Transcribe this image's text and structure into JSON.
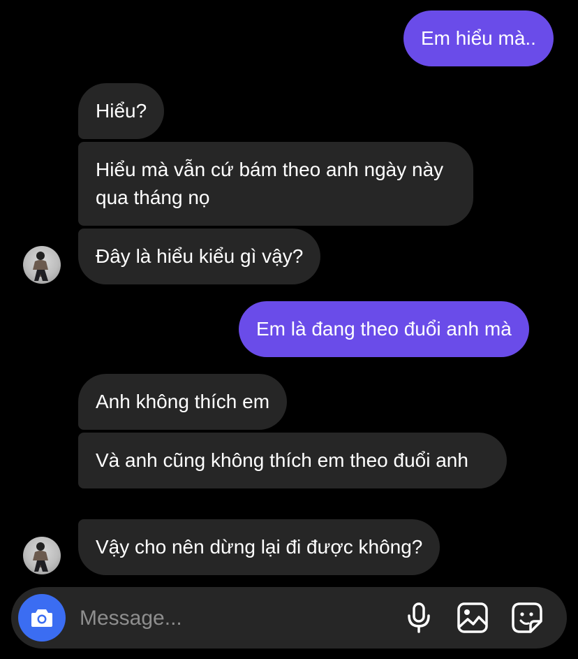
{
  "messages": [
    {
      "direction": "outgoing",
      "text": "Em hiểu mà.."
    },
    {
      "direction": "incoming",
      "text": "Hiểu?"
    },
    {
      "direction": "incoming",
      "text": "Hiểu mà vẫn cứ bám theo anh ngày này qua tháng nọ"
    },
    {
      "direction": "incoming",
      "text": "Đây là hiểu kiểu gì vậy?"
    },
    {
      "direction": "outgoing",
      "text": "Em là đang theo đuổi anh mà"
    },
    {
      "direction": "incoming",
      "text": "Anh không thích em"
    },
    {
      "direction": "incoming",
      "text": "Và anh cũng không thích em theo đuổi anh"
    },
    {
      "direction": "incoming",
      "text": "Vậy cho nên dừng lại đi được không?"
    }
  ],
  "composer": {
    "placeholder": "Message...",
    "icons": [
      "camera-icon",
      "microphone-icon",
      "gallery-icon",
      "sticker-icon"
    ]
  },
  "colors": {
    "background": "#000000",
    "outgoing_bubble": "#6a4ce9",
    "incoming_bubble": "#262626",
    "camera_button": "#3b6df2",
    "placeholder": "#8e8e8e"
  }
}
